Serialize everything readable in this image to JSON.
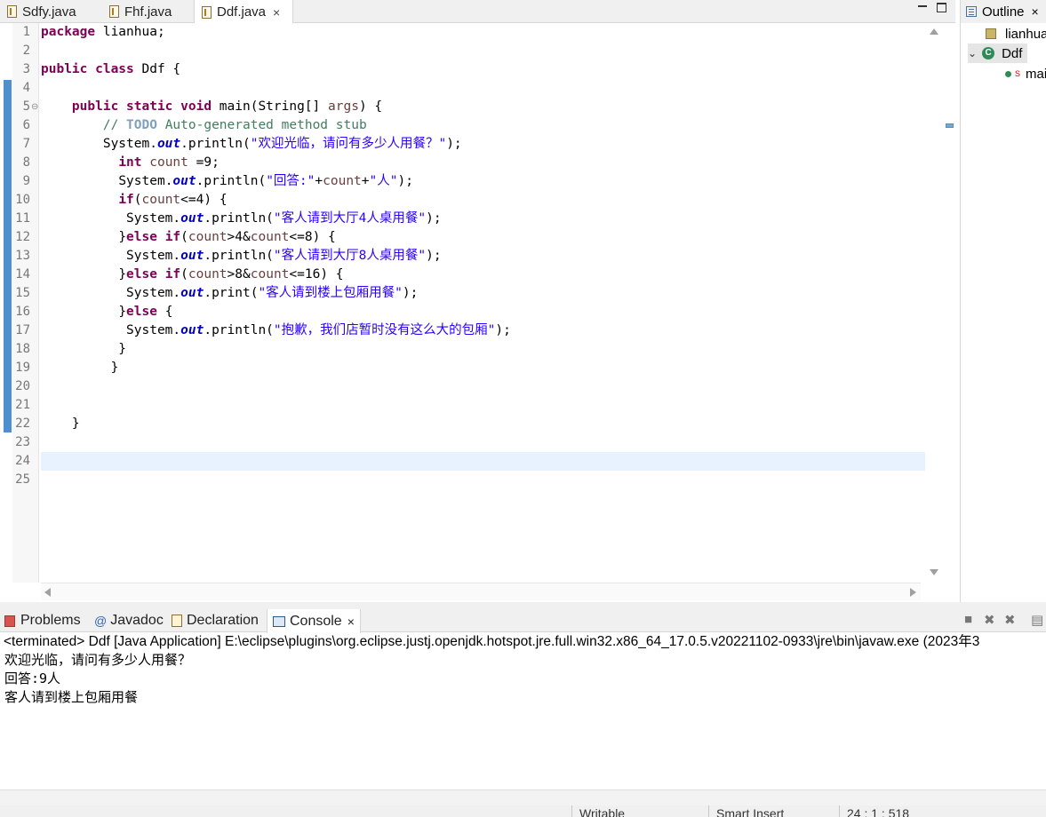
{
  "editor": {
    "tabs": [
      {
        "label": "Sdfy.java"
      },
      {
        "label": "Fhf.java"
      },
      {
        "label": "Ddf.java",
        "close": "×"
      }
    ],
    "code_lines": [
      {
        "num": "1"
      },
      {
        "num": "2"
      },
      {
        "num": "3"
      },
      {
        "num": "4"
      },
      {
        "num": "5"
      },
      {
        "num": "6"
      },
      {
        "num": "7"
      },
      {
        "num": "8"
      },
      {
        "num": "9"
      },
      {
        "num": "10"
      },
      {
        "num": "11"
      },
      {
        "num": "12"
      },
      {
        "num": "13"
      },
      {
        "num": "14"
      },
      {
        "num": "15"
      },
      {
        "num": "16"
      },
      {
        "num": "17"
      },
      {
        "num": "18"
      },
      {
        "num": "19"
      },
      {
        "num": "20"
      },
      {
        "num": "21"
      },
      {
        "num": "22"
      },
      {
        "num": "23"
      },
      {
        "num": "24"
      },
      {
        "num": "25"
      }
    ],
    "code": {
      "l1_kw": "package",
      "l1_rest": " lianhua;",
      "l3_kw": "public class",
      "l3_rest": " Ddf {",
      "l5_indent": "    ",
      "l5_kw": "public static void",
      "l5_a": " main(String[] ",
      "l5_var": "args",
      "l5_b": ") {",
      "l6_indent": "        ",
      "l6_cmt1": "// ",
      "l6_todo": "TODO",
      "l6_cmt2": " Auto-generated method stub",
      "l7_indent": "        ",
      "l7_a": "System.",
      "l7_fld": "out",
      "l7_b": ".println(",
      "l7_str": "\"欢迎光临，请问有多少人用餐？\"",
      "l7_c": ");",
      "l8_indent": "          ",
      "l8_kw": "int",
      "l8_var": " count",
      "l8_rest": " =9;",
      "l9_indent": "          ",
      "l9_a": "System.",
      "l9_fld": "out",
      "l9_b": ".println(",
      "l9_str1": "\"回答:\"",
      "l9_plus1": "+",
      "l9_var": "count",
      "l9_plus2": "+",
      "l9_str2": "\"人\"",
      "l9_c": ");",
      "l10_indent": "          ",
      "l10_kw": "if",
      "l10_a": "(",
      "l10_var": "count",
      "l10_b": "<=4) {",
      "l11_indent": "           ",
      "l11_a": "System.",
      "l11_fld": "out",
      "l11_b": ".println(",
      "l11_str": "\"客人请到大厅4人桌用餐\"",
      "l11_c": ");",
      "l12_indent": "          ",
      "l12_a": "}",
      "l12_kw": "else if",
      "l12_b": "(",
      "l12_var1": "count",
      "l12_c": ">4&",
      "l12_var2": "count",
      "l12_d": "<=8) {",
      "l13_indent": "           ",
      "l13_a": "System.",
      "l13_fld": "out",
      "l13_b": ".println(",
      "l13_str": "\"客人请到大厅8人桌用餐\"",
      "l13_c": ");",
      "l14_indent": "          ",
      "l14_a": "}",
      "l14_kw": "else if",
      "l14_b": "(",
      "l14_var1": "count",
      "l14_c": ">8&",
      "l14_var2": "count",
      "l14_d": "<=16) {",
      "l15_indent": "           ",
      "l15_a": "System.",
      "l15_fld": "out",
      "l15_b": ".print(",
      "l15_str": "\"客人请到楼上包厢用餐\"",
      "l15_c": ");",
      "l16_indent": "          ",
      "l16_a": "}",
      "l16_kw": "else",
      "l16_b": " {",
      "l17_indent": "           ",
      "l17_a": "System.",
      "l17_fld": "out",
      "l17_b": ".println(",
      "l17_str": "\"抱歉，我们店暂时没有这么大的包厢\"",
      "l17_c": ");",
      "l18": "          }",
      "l19": "         }",
      "l22": "    }"
    }
  },
  "outline": {
    "title": "Outline",
    "close": "×",
    "package_label": "lianhua",
    "class_label": "Ddf",
    "method_label": "main"
  },
  "bottom_panel": {
    "tabs": [
      {
        "label": "Problems"
      },
      {
        "label": "Javadoc"
      },
      {
        "label": "Declaration"
      },
      {
        "label": "Console",
        "close": "×"
      }
    ],
    "launch_info": "<terminated> Ddf [Java Application] E:\\eclipse\\plugins\\org.eclipse.justj.openjdk.hotspot.jre.full.win32.x86_64_17.0.5.v20221102-0933\\jre\\bin\\javaw.exe  (2023年3",
    "console_lines": [
      "欢迎光临，请问有多少人用餐？",
      "回答:9人",
      "客人请到楼上包厢用餐"
    ]
  },
  "status_bar": {
    "writable": "Writable",
    "insert_mode": "Smart Insert",
    "position": "24 : 1 : 518"
  }
}
